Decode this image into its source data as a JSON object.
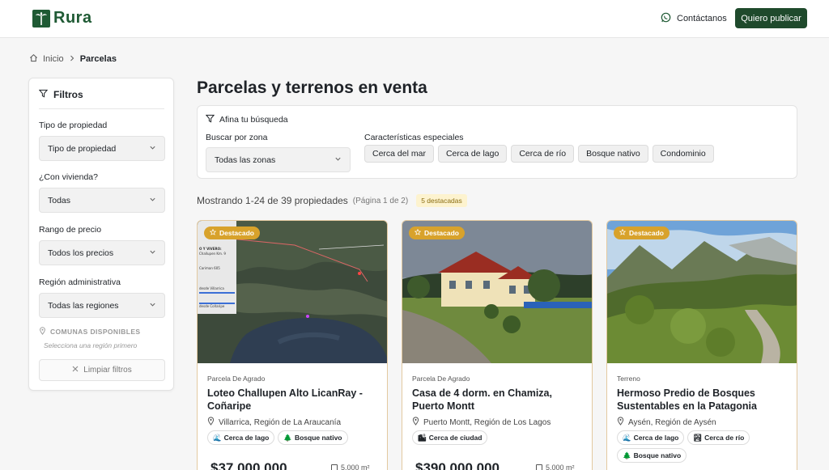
{
  "header": {
    "logo_text": "Rura",
    "contact_label": "Contáctanos",
    "publish_label": "Quiero publicar"
  },
  "breadcrumb": {
    "home": "Inicio",
    "current": "Parcelas"
  },
  "sidebar": {
    "title": "Filtros",
    "filters": [
      {
        "label": "Tipo de propiedad",
        "value": "Tipo de propiedad"
      },
      {
        "label": "¿Con vivienda?",
        "value": "Todas"
      },
      {
        "label": "Rango de precio",
        "value": "Todos los precios"
      },
      {
        "label": "Región administrativa",
        "value": "Todas las regiones"
      }
    ],
    "comunas_label": "COMUNAS DISPONIBLES",
    "comunas_hint": "Selecciona una región primero",
    "clear_label": "Limpiar filtros"
  },
  "main": {
    "title": "Parcelas y terrenos en venta",
    "refine": {
      "title": "Afina tu búsqueda",
      "zone_label": "Buscar por zona",
      "zone_value": "Todas las zonas",
      "chars_label": "Características especiales",
      "chips": [
        "Cerca del mar",
        "Cerca de lago",
        "Cerca de río",
        "Bosque nativo",
        "Condominio"
      ]
    },
    "results": {
      "main": "Mostrando 1-24 de 39 propiedades",
      "page": "(Página 1 de 2)",
      "badge": "5 destacadas"
    }
  },
  "cards": [
    {
      "badge": "Destacado",
      "type": "Parcela De Agrado",
      "title": "Loteo Challupen Alto LicanRay - Coñaripe",
      "location": "Villarrica, Región de La Araucanía",
      "tags": [
        {
          "icon": "lake-icon",
          "label": "Cerca de lago"
        },
        {
          "icon": "tree-icon",
          "label": "Bosque nativo"
        }
      ],
      "price": "$37.000.000",
      "area": "5.000 m²"
    },
    {
      "badge": "Destacado",
      "type": "Parcela De Agrado",
      "title": "Casa de 4 dorm. en Chamiza, Puerto Montt",
      "location": "Puerto Montt, Región de Los Lagos",
      "tags": [
        {
          "icon": "city-icon",
          "label": "Cerca de ciudad"
        }
      ],
      "price": "$390.000.000",
      "area": "5.000 m²"
    },
    {
      "badge": "Destacado",
      "type": "Terreno",
      "title": "Hermoso Predio de Bosques Sustentables en la Patagonia",
      "location": "Aysén, Región de Aysén",
      "tags": [
        {
          "icon": "lake-icon",
          "label": "Cerca de lago"
        },
        {
          "icon": "river-icon",
          "label": "Cerca de río"
        },
        {
          "icon": "tree-icon",
          "label": "Bosque nativo"
        }
      ],
      "price": "",
      "area": ""
    }
  ],
  "map_labels": [
    "O Y VIVERO:",
    "Challupen Km. 9",
    "Cariman 605",
    "desde Villarrica",
    "desde Coñaripe"
  ]
}
